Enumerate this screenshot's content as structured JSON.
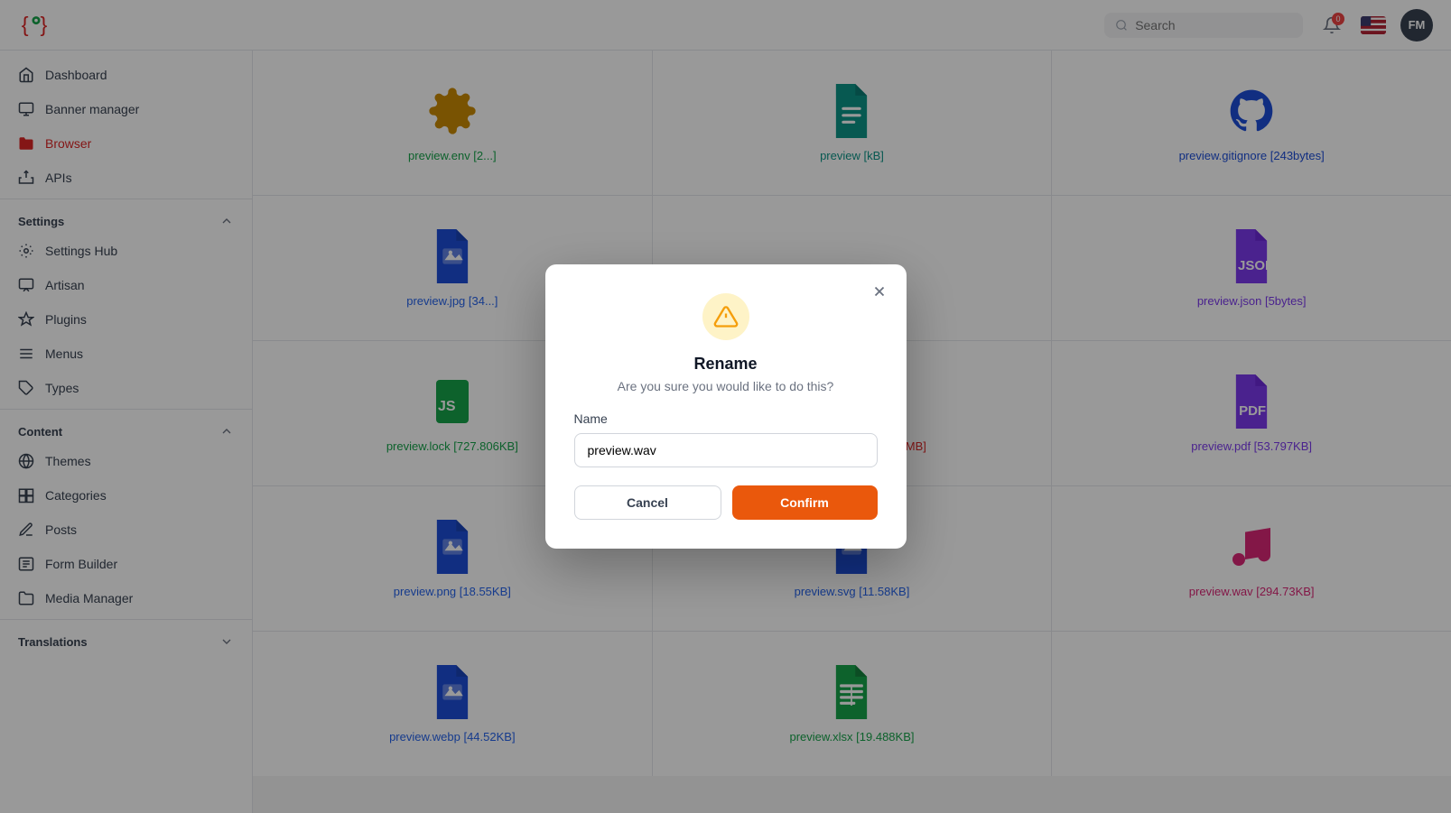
{
  "topnav": {
    "search_placeholder": "Search",
    "notification_count": "0",
    "avatar_initials": "FM"
  },
  "sidebar": {
    "nav_items": [
      {
        "id": "dashboard",
        "label": "Dashboard",
        "icon": "home-icon",
        "active": false
      },
      {
        "id": "banner-manager",
        "label": "Banner manager",
        "icon": "banner-icon",
        "active": false
      },
      {
        "id": "browser",
        "label": "Browser",
        "icon": "folder-icon",
        "active": true
      }
    ],
    "other_items": [
      {
        "id": "apis",
        "label": "APIs",
        "icon": "api-icon",
        "active": false
      }
    ],
    "settings_section": {
      "label": "Settings",
      "items": [
        {
          "id": "settings-hub",
          "label": "Settings Hub",
          "icon": "settings-hub-icon"
        },
        {
          "id": "artisan",
          "label": "Artisan",
          "icon": "artisan-icon"
        },
        {
          "id": "plugins",
          "label": "Plugins",
          "icon": "plugins-icon"
        },
        {
          "id": "menus",
          "label": "Menus",
          "icon": "menus-icon"
        },
        {
          "id": "types",
          "label": "Types",
          "icon": "types-icon"
        }
      ]
    },
    "content_section": {
      "label": "Content",
      "items": [
        {
          "id": "themes",
          "label": "Themes",
          "icon": "themes-icon"
        },
        {
          "id": "categories",
          "label": "Categories",
          "icon": "categories-icon"
        },
        {
          "id": "posts",
          "label": "Posts",
          "icon": "posts-icon"
        },
        {
          "id": "form-builder",
          "label": "Form Builder",
          "icon": "form-builder-icon"
        },
        {
          "id": "media-manager",
          "label": "Media Manager",
          "icon": "media-manager-icon"
        }
      ]
    },
    "translations_section": {
      "label": "Translations"
    }
  },
  "file_grid": {
    "files": [
      {
        "id": "env",
        "name": "preview.env [2...]",
        "icon_type": "gear",
        "icon_color": "#ca8a04",
        "name_color": "green"
      },
      {
        "id": "gitignore_file",
        "name": "preview [kB]",
        "icon_type": "doc-teal",
        "icon_color": "#0d9488",
        "name_color": "teal"
      },
      {
        "id": "gitignore",
        "name": "preview.gitignore [243bytes]",
        "icon_type": "github",
        "icon_color": "#1d4ed8",
        "name_color": "github"
      },
      {
        "id": "jpg",
        "name": "preview.jpg [34...]",
        "icon_type": "image-blue",
        "icon_color": "#1d4ed8",
        "name_color": "blue"
      },
      {
        "id": "empty1",
        "name": "",
        "icon_type": "none",
        "icon_color": "",
        "name_color": ""
      },
      {
        "id": "json",
        "name": "preview.json [5bytes]",
        "icon_type": "json",
        "icon_color": "#7c3aed",
        "name_color": "purple"
      },
      {
        "id": "lock",
        "name": "preview.lock [727.806KB]",
        "icon_type": "js",
        "icon_color": "#16a34a",
        "name_color": "green"
      },
      {
        "id": "mp4",
        "name": "preview.mp4 [1.5700024MB]",
        "icon_type": "video-red",
        "icon_color": "#dc2626",
        "name_color": "red"
      },
      {
        "id": "pdf",
        "name": "preview.pdf [53.797KB]",
        "icon_type": "pdf",
        "icon_color": "#7c3aed",
        "name_color": "purple"
      },
      {
        "id": "png",
        "name": "preview.png [18.55KB]",
        "icon_type": "image-blue",
        "icon_color": "#1d4ed8",
        "name_color": "blue"
      },
      {
        "id": "svg",
        "name": "preview.svg [11.58KB]",
        "icon_type": "image-blue2",
        "icon_color": "#1d4ed8",
        "name_color": "blue"
      },
      {
        "id": "wav",
        "name": "preview.wav [294.73KB]",
        "icon_type": "music",
        "icon_color": "#db2777",
        "name_color": "magenta"
      },
      {
        "id": "webp",
        "name": "preview.webp [44.52KB]",
        "icon_type": "image-blue3",
        "icon_color": "#1d4ed8",
        "name_color": "blue"
      },
      {
        "id": "xlsx",
        "name": "preview.xlsx [19.488KB]",
        "icon_type": "spreadsheet",
        "icon_color": "#16a34a",
        "name_color": "green"
      },
      {
        "id": "empty2",
        "name": "",
        "icon_type": "none",
        "icon_color": "",
        "name_color": ""
      }
    ]
  },
  "modal": {
    "title": "Rename",
    "subtitle": "Are you sure you would like to do this?",
    "name_label": "Name",
    "input_value": "preview.wav",
    "cancel_label": "Cancel",
    "confirm_label": "Confirm"
  }
}
